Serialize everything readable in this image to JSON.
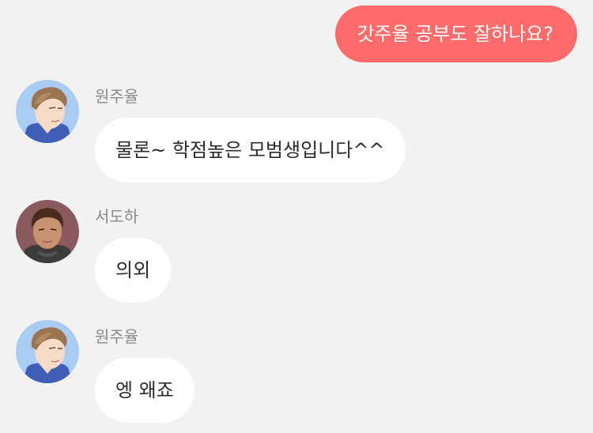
{
  "theme": {
    "background": "#f2f2f2",
    "outgoing_bubble": "#ff6b6b",
    "incoming_bubble": "#ffffff",
    "sender_text": "#8a8a8a",
    "message_text": "#2b2b2b"
  },
  "chat": {
    "outgoing": [
      {
        "text": "갓주율 공부도 잘하나요?"
      }
    ],
    "incoming": [
      {
        "sender": "원주율",
        "avatar_icon": "avatar-icon-wonjuyul",
        "text": "물론~ 학점높은 모범생입니다^^"
      },
      {
        "sender": "서도하",
        "avatar_icon": "avatar-icon-seodoha",
        "text": "의외"
      },
      {
        "sender": "원주율",
        "avatar_icon": "avatar-icon-wonjuyul",
        "text": "엥 왜죠"
      }
    ]
  }
}
